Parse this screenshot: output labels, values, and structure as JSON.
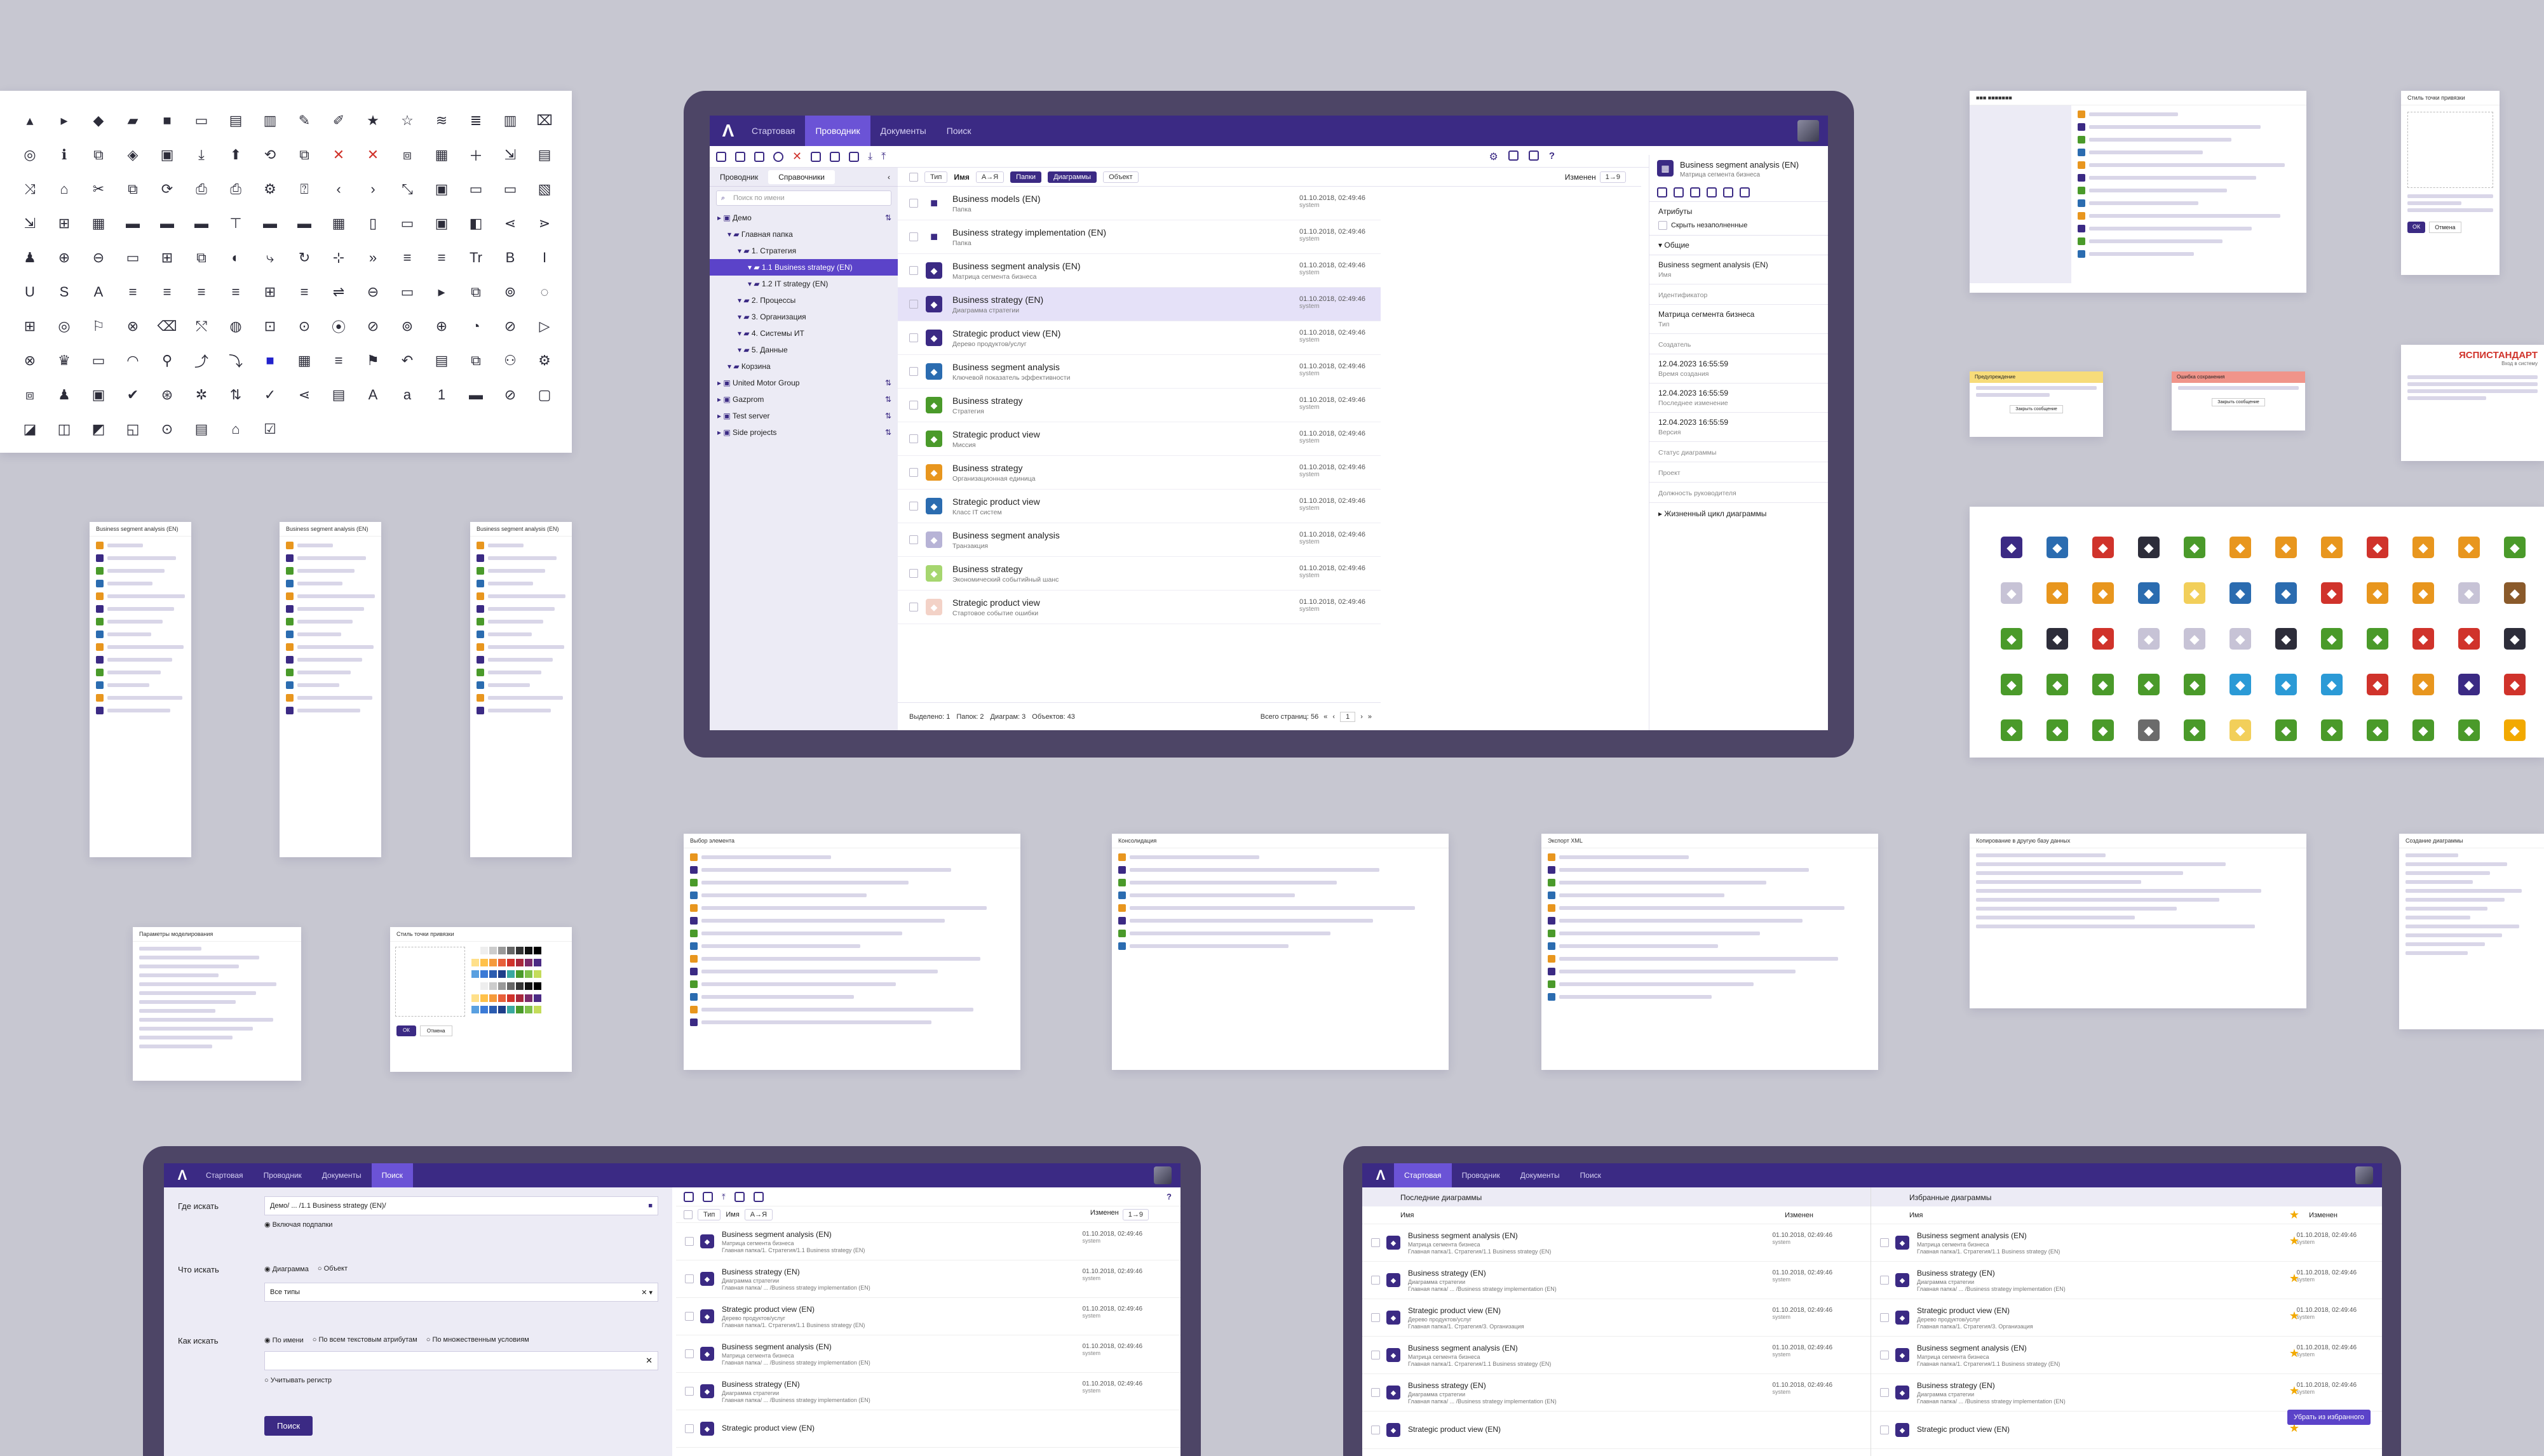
{
  "main": {
    "tabs": [
      "Стартовая",
      "Проводник",
      "Документы",
      "Поиск"
    ],
    "active_tab": "Проводник",
    "tree_tabs": [
      "Проводник",
      "Справочники"
    ],
    "search_placeholder": "Поиск по имени",
    "tree": [
      {
        "label": "Демо",
        "level": 0
      },
      {
        "label": "Главная папка",
        "level": 1
      },
      {
        "label": "1. Стратегия",
        "level": 2
      },
      {
        "label": "1.1 Business strategy (EN)",
        "level": 3,
        "selected": true
      },
      {
        "label": "1.2 IT strategy (EN)",
        "level": 3
      },
      {
        "label": "2. Процессы",
        "level": 2
      },
      {
        "label": "3. Организация",
        "level": 2
      },
      {
        "label": "4. Системы ИТ",
        "level": 2
      },
      {
        "label": "5. Данные",
        "level": 2
      },
      {
        "label": "Корзина",
        "level": 1
      },
      {
        "label": "United Motor Group",
        "level": 0
      },
      {
        "label": "Gazprom",
        "level": 0
      },
      {
        "label": "Test server",
        "level": 0
      },
      {
        "label": "Side projects",
        "level": 0
      }
    ],
    "filter": {
      "type_label": "Тип",
      "name_label": "Имя",
      "name_sort": "А→Я",
      "pills": [
        "Папки",
        "Диаграммы",
        "Объект"
      ],
      "changed_label": "Изменен",
      "changed_sort": "1→9"
    },
    "items": [
      {
        "name": "Business models (EN)",
        "sub": "Папка",
        "date": "01.10.2018, 02:49:46",
        "user": "system",
        "color": "#3b2a84",
        "icon": "folder-icon"
      },
      {
        "name": "Business strategy implementation (EN)",
        "sub": "Папка",
        "date": "01.10.2018, 02:49:46",
        "user": "system",
        "color": "#3b2a84",
        "icon": "folder-icon"
      },
      {
        "name": "Business segment analysis (EN)",
        "sub": "Матрица сегмента бизнеса",
        "date": "01.10.2018, 02:49:46",
        "user": "system",
        "color": "#3b2a84",
        "icon": "matrix-icon"
      },
      {
        "name": "Business strategy (EN)",
        "sub": "Диаграмма стратегии",
        "date": "01.10.2018, 02:49:46",
        "user": "system",
        "color": "#3b2a84",
        "icon": "strategy-diagram-icon",
        "selected": true
      },
      {
        "name": "Strategic product view (EN)",
        "sub": "Дерево продуктов/услуг",
        "date": "01.10.2018, 02:49:46",
        "user": "system",
        "color": "#3b2a84",
        "icon": "product-tree-icon"
      },
      {
        "name": "Business segment analysis",
        "sub": "Ключевой показатель эффективности",
        "date": "01.10.2018, 02:49:46",
        "user": "system",
        "color": "#2b6cb0",
        "icon": "kpi-icon"
      },
      {
        "name": "Business strategy",
        "sub": "Стратегия",
        "date": "01.10.2018, 02:49:46",
        "user": "system",
        "color": "#4a9a2a",
        "icon": "strategy-icon"
      },
      {
        "name": "Strategic product view",
        "sub": "Миссия",
        "date": "01.10.2018, 02:49:46",
        "user": "system",
        "color": "#4a9a2a",
        "icon": "mission-icon"
      },
      {
        "name": "Business strategy",
        "sub": "Организационная единица",
        "date": "01.10.2018, 02:49:46",
        "user": "system",
        "color": "#e8961e",
        "icon": "org-unit-icon"
      },
      {
        "name": "Strategic product view",
        "sub": "Класс IT систем",
        "date": "01.10.2018, 02:49:46",
        "user": "system",
        "color": "#2b6cb0",
        "icon": "it-class-icon"
      },
      {
        "name": "Business segment analysis",
        "sub": "Транзакция",
        "date": "01.10.2018, 02:49:46",
        "user": "system",
        "color": "#b7b3d6",
        "icon": "transaction-icon"
      },
      {
        "name": "Business strategy",
        "sub": "Экономический событийный шанс",
        "date": "01.10.2018, 02:49:46",
        "user": "system",
        "color": "#a6d66f",
        "icon": "event-icon"
      },
      {
        "name": "Strategic product view",
        "sub": "Стартовое событие ошибки",
        "date": "01.10.2018, 02:49:46",
        "user": "system",
        "color": "#f3d2c7",
        "icon": "error-event-icon"
      }
    ],
    "footer": {
      "selected": "Выделено: 1",
      "folders": "Папок: 2",
      "diagrams": "Диаграм: 3",
      "objects": "Объектов: 43",
      "pages": "Всего страниц: 56",
      "page": "1"
    },
    "props": {
      "title": "Business segment analysis (EN)",
      "subtitle": "Матрица сегмента бизнеса",
      "attributes": "Атрибуты",
      "hide_empty": "Скрыть незаполненные",
      "general": "Общие",
      "rows": [
        {
          "v": "Business segment analysis (EN)",
          "l": "Имя"
        },
        {
          "v": "",
          "l": "Идентификатор"
        },
        {
          "v": "Матрица сегмента бизнеса",
          "l": "Тип"
        },
        {
          "v": "",
          "l": "Создатель"
        },
        {
          "v": "12.04.2023 16:55:59",
          "l": "Время создания"
        },
        {
          "v": "12.04.2023 16:55:59",
          "l": "Последнее изменение"
        },
        {
          "v": "12.04.2023 16:55:59",
          "l": "Версия"
        },
        {
          "v": "",
          "l": "Статус диаграммы"
        },
        {
          "v": "",
          "l": "Проект"
        },
        {
          "v": "",
          "l": "Должность руководителя"
        }
      ],
      "lifecycle": "Жизненный цикл диаграммы"
    }
  },
  "search_screen": {
    "tabs": [
      "Стартовая",
      "Проводник",
      "Документы",
      "Поиск"
    ],
    "active_tab": "Поиск",
    "where_label": "Где искать",
    "where_value": "Демо/ ... /1.1 Business strategy (EN)/",
    "include_sub": "Включая подпапки",
    "what_label": "Что искать",
    "what_options": [
      "Диаграмма",
      "Объект"
    ],
    "types_value": "Все типы",
    "how_label": "Как искать",
    "how_options": [
      "По имени",
      "По всем текстовым атрибутам",
      "По множественным условиям"
    ],
    "case": "Учитывать регистр",
    "button": "Поиск",
    "col_type": "Тип",
    "col_name": "Имя",
    "col_name_sort": "А→Я",
    "col_changed": "Изменен",
    "col_changed_sort": "1→9",
    "results": [
      {
        "name": "Business segment analysis (EN)",
        "sub": "Матрица сегмента бизнеса",
        "path": "Главная папка/1. Стратегия/1.1 Business strategy (EN)",
        "date": "01.10.2018, 02:49:46",
        "user": "system"
      },
      {
        "name": "Business strategy (EN)",
        "sub": "Диаграмма стратегии",
        "path": "Главная папка/ ... /Business strategy implementation (EN)",
        "date": "01.10.2018, 02:49:46",
        "user": "system"
      },
      {
        "name": "Strategic product view (EN)",
        "sub": "Дерево продуктов/услуг",
        "path": "Главная папка/1. Стратегия/1.1 Business strategy (EN)",
        "date": "01.10.2018, 02:49:46",
        "user": "system"
      },
      {
        "name": "Business segment analysis (EN)",
        "sub": "Матрица сегмента бизнеса",
        "path": "Главная папка/ ... /Business strategy implementation (EN)",
        "date": "01.10.2018, 02:49:46",
        "user": "system"
      },
      {
        "name": "Business strategy (EN)",
        "sub": "Диаграмма стратегии",
        "path": "Главная папка/ ... /Business strategy implementation (EN)",
        "date": "01.10.2018, 02:49:46",
        "user": "system"
      },
      {
        "name": "Strategic product view (EN)",
        "sub": "",
        "path": "",
        "date": "",
        "user": ""
      }
    ]
  },
  "start_screen": {
    "tabs": [
      "Стартовая",
      "Проводник",
      "Документы",
      "Поиск"
    ],
    "active_tab": "Стартовая",
    "recent_title": "Последние диаграммы",
    "fav_title": "Избранные диаграммы",
    "col_name": "Имя",
    "col_changed": "Изменен",
    "remove_fav": "Убрать из избранного",
    "recent": [
      {
        "name": "Business segment analysis (EN)",
        "sub": "Матрица сегмента бизнеса",
        "path": "Главная папка/1. Стратегия/1.1 Business strategy (EN)",
        "date": "01.10.2018, 02:49:46",
        "user": "system"
      },
      {
        "name": "Business strategy (EN)",
        "sub": "Диаграмма стратегии",
        "path": "Главная папка/ ... /Business strategy implementation (EN)",
        "date": "01.10.2018, 02:49:46",
        "user": "system"
      },
      {
        "name": "Strategic product view (EN)",
        "sub": "Дерево продуктов/услуг",
        "path": "Главная папка/1. Стратегия/3. Организация",
        "date": "01.10.2018, 02:49:46",
        "user": "system"
      },
      {
        "name": "Business segment analysis (EN)",
        "sub": "Матрица сегмента бизнеса",
        "path": "Главная папка/1. Стратегия/1.1 Business strategy (EN)",
        "date": "01.10.2018, 02:49:46",
        "user": "system"
      },
      {
        "name": "Business strategy (EN)",
        "sub": "Диаграмма стратегии",
        "path": "Главная папка/ ... /Business strategy implementation (EN)",
        "date": "01.10.2018, 02:49:46",
        "user": "system"
      },
      {
        "name": "Strategic product view (EN)",
        "sub": "",
        "path": "",
        "date": "",
        "user": ""
      }
    ],
    "favorites": [
      {
        "name": "Business segment analysis (EN)",
        "sub": "Матрица сегмента бизнеса",
        "path": "Главная папка/1. Стратегия/1.1 Business strategy (EN)",
        "date": "01.10.2018, 02:49:46",
        "user": "system"
      },
      {
        "name": "Business strategy (EN)",
        "sub": "Диаграмма стратегии",
        "path": "Главная папка/ ... /Business strategy implementation (EN)",
        "date": "01.10.2018, 02:49:46",
        "user": "system"
      },
      {
        "name": "Strategic product view (EN)",
        "sub": "Дерево продуктов/услуг",
        "path": "Главная папка/1. Стратегия/3. Организация",
        "date": "01.10.2018, 02:49:46",
        "user": "system"
      },
      {
        "name": "Business segment analysis (EN)",
        "sub": "Матрица сегмента бизнеса",
        "path": "Главная папка/1. Стратегия/1.1 Business strategy (EN)",
        "date": "01.10.2018, 02:49:46",
        "user": "system"
      },
      {
        "name": "Business strategy (EN)",
        "sub": "Диаграмма стратегии",
        "path": "Главная папка/ ... /Business strategy implementation (EN)",
        "date": "01.10.2018, 02:49:46",
        "user": "system"
      },
      {
        "name": "Strategic product view (EN)",
        "sub": "",
        "path": "",
        "date": "",
        "user": ""
      }
    ]
  },
  "small_panels": {
    "brand": "ЯСПИСТАНДАРТ",
    "brand_sub": "Вход в систему",
    "warning_title": "Предупреждение",
    "warning_btn": "Закрыть сообщение",
    "error_title": "Ошибка сохранения",
    "error_btn": "Закрыть сообщение",
    "ok": "ОК",
    "cancel": "Отмена",
    "side_title": "Business segment analysis (EN)",
    "side_sub": "Матрица сегмента бизнеса",
    "dialog_choose": "Выбор элемента",
    "dialog_consolidation": "Консолидация",
    "dialog_export": "Экспорт XML",
    "dialog_import": "Копирование в другую базу данных",
    "dialog_create": "Создание диаграммы",
    "dialog_params": "Параметры моделирования",
    "dialog_style": "Стиль точки привязки"
  },
  "colors": {
    "brand": "#3b2a84",
    "accent": "#6b53d6",
    "background": "#c7c7d1",
    "frame": "#4d4566",
    "green": "#4a9a2a",
    "orange": "#e8961e",
    "blue": "#2b6cb0",
    "red": "#d0332b"
  }
}
